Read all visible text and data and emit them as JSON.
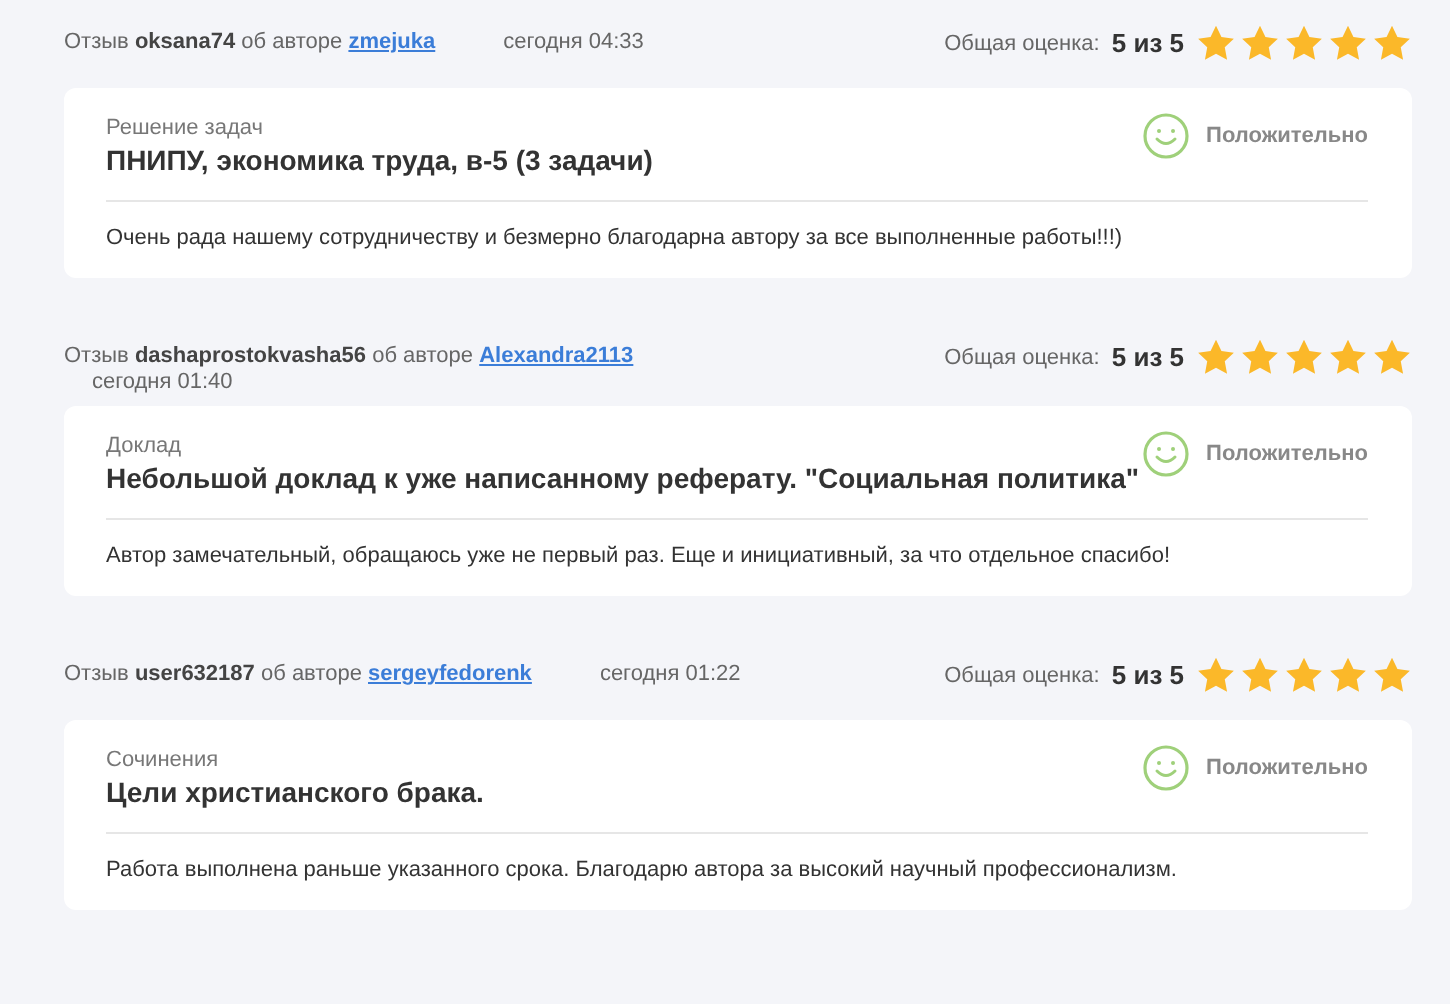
{
  "reviews": [
    {
      "prefix": "Отзыв",
      "reviewer": "oksana74",
      "middle": "об авторе",
      "author": "zmejuka",
      "time": "сегодня 04:33",
      "rating_label": "Общая оценка:",
      "score": "5 из 5",
      "stars": 5,
      "category": "Решение задач",
      "title": "ПНИПУ, экономика труда, в-5 (3 задачи)",
      "verdict": "Положительно",
      "text": "Очень рада нашему сотрудничеству и безмерно благодарна автору за все выполненные работы!!!)"
    },
    {
      "prefix": "Отзыв",
      "reviewer": "dashaprostokvasha56",
      "middle": "об авторе",
      "author": "Alexandra2113",
      "time": "сегодня 01:40",
      "rating_label": "Общая оценка:",
      "score": "5 из 5",
      "stars": 5,
      "category": "Доклад",
      "title": "Небольшой доклад к уже написанному реферату. \"Социальная политика\"",
      "verdict": "Положительно",
      "text": "Автор замечательный, обращаюсь уже не первый раз. Еще и инициативный, за что отдельное спасибо!"
    },
    {
      "prefix": "Отзыв",
      "reviewer": "user632187",
      "middle": "об авторе",
      "author": "sergeyfedorenk",
      "time": "сегодня 01:22",
      "rating_label": "Общая оценка:",
      "score": "5 из 5",
      "stars": 5,
      "category": "Сочинения",
      "title": "Цели христианского брака.",
      "verdict": "Положительно",
      "text": "Работа выполнена раньше указанного срока. Благодарю автора за высокий научный профессионализм."
    }
  ]
}
